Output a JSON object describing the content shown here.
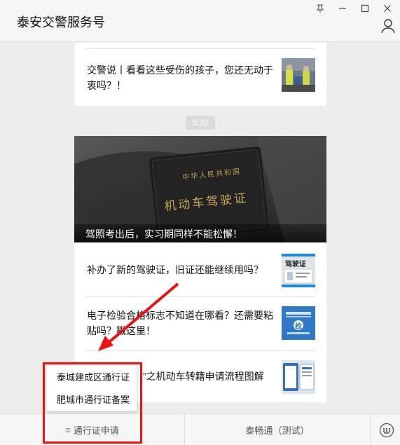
{
  "window": {
    "title": "泰安交警服务号"
  },
  "articles_top": {
    "text": "交警说丨看看这些受伤的孩子，您还无动于衷吗？！"
  },
  "timestamp": "9:32",
  "articles_group": {
    "hero_caption": "驾照考出后，实习期同样不能松懈！",
    "hero_card_text": "机动车驾驶证",
    "hero_card_header": "中华人民共和国",
    "items": [
      {
        "text": "补办了新的驾驶证，旧证还能继续用吗？",
        "thumb_label": "驾驶证"
      },
      {
        "text": "电子检验合格标志不知道在哪看？还需要粘贴吗？戳这里！",
        "thumb_label": "检"
      },
      {
        "text": "”之机动车转籍申请流程图解",
        "thumb_label": ""
      }
    ]
  },
  "menu": {
    "left_label": "通行证申请",
    "right_label": "泰畅通（测试）",
    "submenu": [
      {
        "label": "泰城建成区通行证"
      },
      {
        "label": "肥城市通行证备案"
      }
    ]
  },
  "colors": {
    "annotation": "#ee1111",
    "background": "#ededed"
  }
}
